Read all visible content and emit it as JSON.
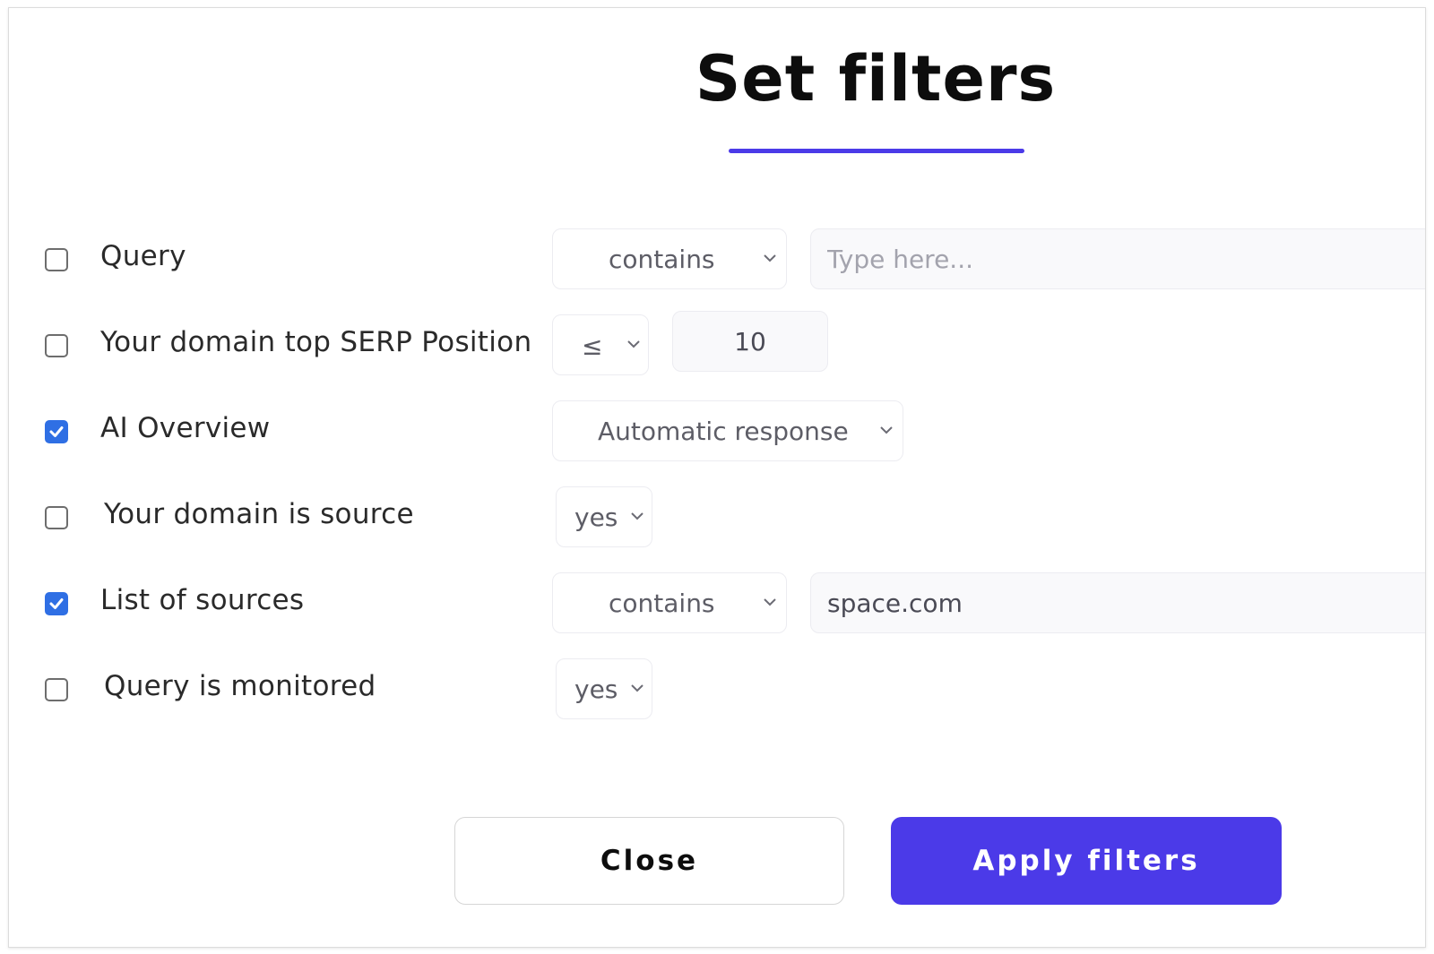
{
  "modal": {
    "title": "Set filters",
    "accent_color": "#4b3ae8",
    "checkbox_color": "#2f6fe4"
  },
  "filters": [
    {
      "label": "Query",
      "checked": false,
      "operator": "contains",
      "value": "",
      "placeholder": "Type here..."
    },
    {
      "label": "Your domain top SERP Position",
      "checked": false,
      "operator": "≤",
      "value": "10"
    },
    {
      "label": "AI Overview",
      "checked": true,
      "operator": "Automatic response"
    },
    {
      "label": "Your domain is source",
      "checked": false,
      "operator": "yes"
    },
    {
      "label": "List of sources",
      "checked": true,
      "operator": "contains",
      "value": "space.com"
    },
    {
      "label": "Query is monitored",
      "checked": false,
      "operator": "yes"
    }
  ],
  "buttons": {
    "close": "Close",
    "apply": "Apply filters"
  }
}
